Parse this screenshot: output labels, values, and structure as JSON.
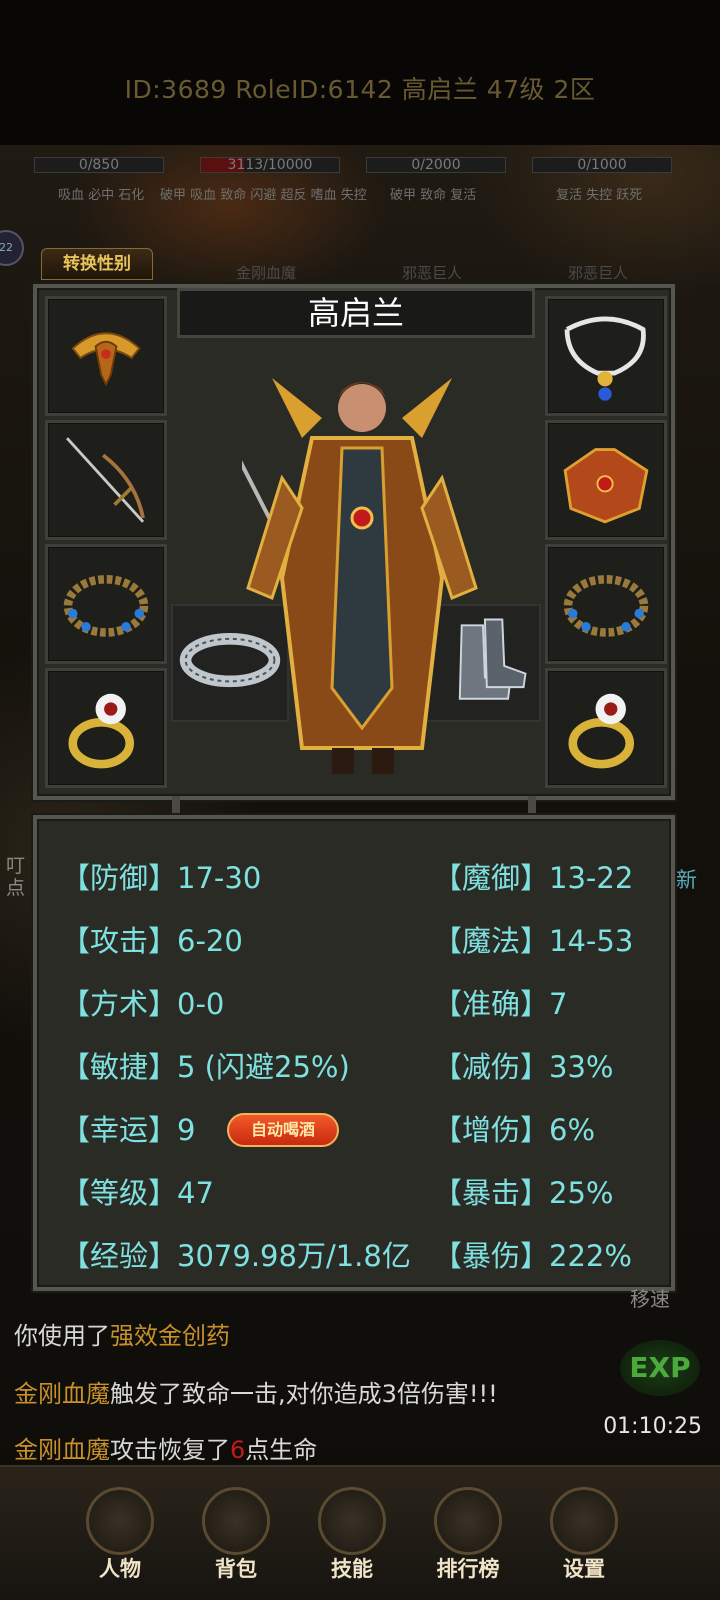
{
  "header": {
    "id_line": "ID:3689  RoleID:6142  高启兰  47级  2区"
  },
  "background": {
    "bars": [
      {
        "text": "0/850",
        "fill": 0
      },
      {
        "text": "3113/10000",
        "fill": 0.3113
      },
      {
        "text": "0/2000",
        "fill": 0
      },
      {
        "text": "0/1000",
        "fill": 0
      }
    ],
    "bar_labels": [
      "吸血 必中 石化",
      "破甲 吸血 致命 闪避 超反 嗜血 失控",
      "破甲 致命 复活",
      "复活 失控 跃死"
    ],
    "monster_names": [
      "金刚血魔",
      "邪恶巨人",
      "邪恶巨人"
    ],
    "left_badge": "22",
    "side_new": "新",
    "side_ding": "叮\n点",
    "move_speed": "移速"
  },
  "gender_button": "转换性别",
  "character": {
    "name": "高启兰",
    "slots_left": [
      "helmet",
      "weapon",
      "bracelet",
      "ring"
    ],
    "slots_right": [
      "necklace",
      "armor",
      "bracelet",
      "ring"
    ],
    "slots_mid": [
      "belt",
      "boots"
    ]
  },
  "stats": {
    "defense": {
      "label": "【防御】",
      "value": "17-30"
    },
    "magic_defense": {
      "label": "【魔御】",
      "value": "13-22"
    },
    "attack": {
      "label": "【攻击】",
      "value": "6-20"
    },
    "magic": {
      "label": "【魔法】",
      "value": "14-53"
    },
    "taoism": {
      "label": "【方术】",
      "value": "0-0"
    },
    "accuracy": {
      "label": "【准确】",
      "value": "7"
    },
    "agility": {
      "label": "【敏捷】",
      "value": "5 (闪避25%)"
    },
    "damage_reduction": {
      "label": "【减伤】",
      "value": "33%"
    },
    "luck": {
      "label": "【幸运】",
      "value": "9"
    },
    "damage_bonus": {
      "label": "【增伤】",
      "value": "6%"
    },
    "level": {
      "label": "【等级】",
      "value": "47"
    },
    "crit": {
      "label": "【暴击】",
      "value": "25%"
    },
    "exp": {
      "label": "【经验】",
      "value": "3079.98万/1.8亿"
    },
    "crit_damage": {
      "label": "【暴伤】",
      "value": "222%"
    },
    "auto_drink_button": "自动喝酒"
  },
  "chat": {
    "line1_prefix": "你使用了",
    "line1_item": "强效金创药",
    "line2_name": "金刚血魔",
    "line2_text": "触发了致命一击,对你造成3倍伤害!!!",
    "line3_name": "金刚血魔",
    "line3_text_a": "攻击恢复了",
    "line3_num": "6",
    "line3_text_b": "点生命"
  },
  "clock": "01:10:25",
  "exp_badge": "EXP",
  "nav": [
    "人物",
    "背包",
    "技能",
    "排行榜",
    "设置"
  ],
  "colors": {
    "stat_text": "#7fe0e0",
    "gold_name": "#c8902a",
    "panel_bg": "#2b2b26"
  }
}
